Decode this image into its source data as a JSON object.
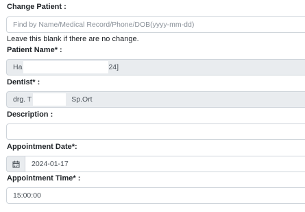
{
  "change_patient": {
    "label": "Change Patient :",
    "placeholder": "Find by Name/Medical Record/Phone/DOB(yyyy-mm-dd)",
    "help": "Leave this blank if there are no change."
  },
  "patient_name": {
    "label": "Patient Name* :",
    "value_start": "Ha",
    "value_end": "24]"
  },
  "dentist": {
    "label": "Dentist* :",
    "value_start": "drg. T",
    "value_end": "Sp.Ort"
  },
  "description": {
    "label": "Description :",
    "value": ""
  },
  "appointment_date": {
    "label": "Appointment Date*:",
    "value": "2024-01-17",
    "icon": "calendar-icon"
  },
  "appointment_time": {
    "label": "Appointment Time* :",
    "value": "15:00:00"
  }
}
